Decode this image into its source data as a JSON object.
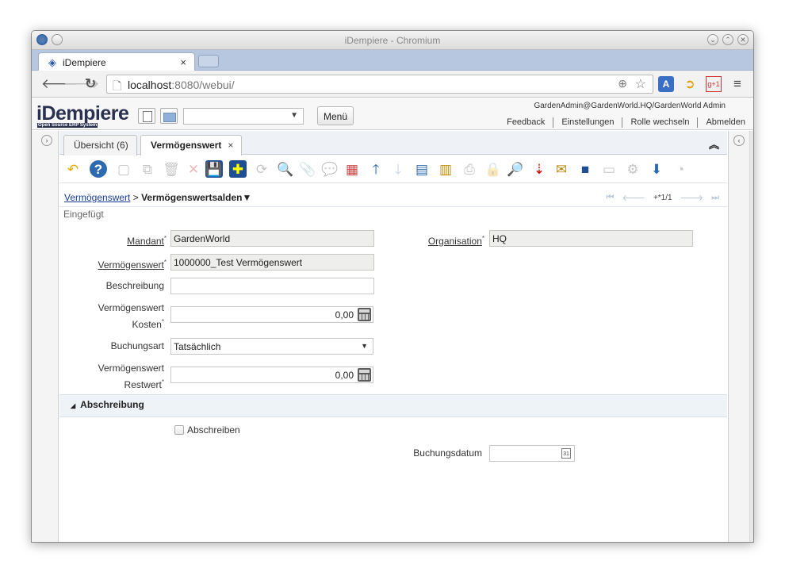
{
  "window": {
    "title": "iDempiere - Chromium"
  },
  "browser": {
    "tab_title": "iDempiere",
    "tab_close": "×",
    "url_host": "localhost",
    "url_rest": ":8080/webui/"
  },
  "header": {
    "logo_text": "iDempiere",
    "logo_sub": "Open Source ERP System",
    "menu_label": "Menü",
    "user_info": "GardenAdmin@GardenWorld.HQ/GardenWorld Admin",
    "links": [
      "Feedback",
      "Einstellungen",
      "Rolle wechseln",
      "Abmelden"
    ]
  },
  "window_tabs": [
    {
      "label": "Übersicht (6)"
    },
    {
      "label": "Vermögenswert",
      "close": "×"
    }
  ],
  "breadcrumb": {
    "parent": "Vermögenswert",
    "sep": ">",
    "current": "Vermögenswertsalden",
    "caret": "▼"
  },
  "navigator": {
    "count": "+*1/1"
  },
  "status": "Eingefügt",
  "form": {
    "mandant_label": "Mandant",
    "mandant_value": "GardenWorld",
    "organisation_label": "Organisation",
    "organisation_value": "HQ",
    "asset_label": "Vermögenswert",
    "asset_value": "1000000_Test Vermögenswert",
    "description_label": "Beschreibung",
    "description_value": "",
    "cost_label_1": "Vermögenswert",
    "cost_label_2": "Kosten",
    "cost_value": "0,00",
    "posting_type_label": "Buchungsart",
    "posting_type_value": "Tatsächlich",
    "residual_label_1": "Vermögenswert",
    "residual_label_2": "Restwert",
    "residual_value": "0,00",
    "mandatory_mark": "*"
  },
  "section": {
    "toggle": "◢",
    "title": "Abschreibung",
    "checkbox_label": "Abschreiben",
    "date_label": "Buchungsdatum",
    "date_value": "",
    "calendar_day": "31"
  },
  "colors": {
    "accent": "#1a3c9a",
    "tabstrip": "#b7c7e0",
    "readonly": "#eeeeec"
  }
}
